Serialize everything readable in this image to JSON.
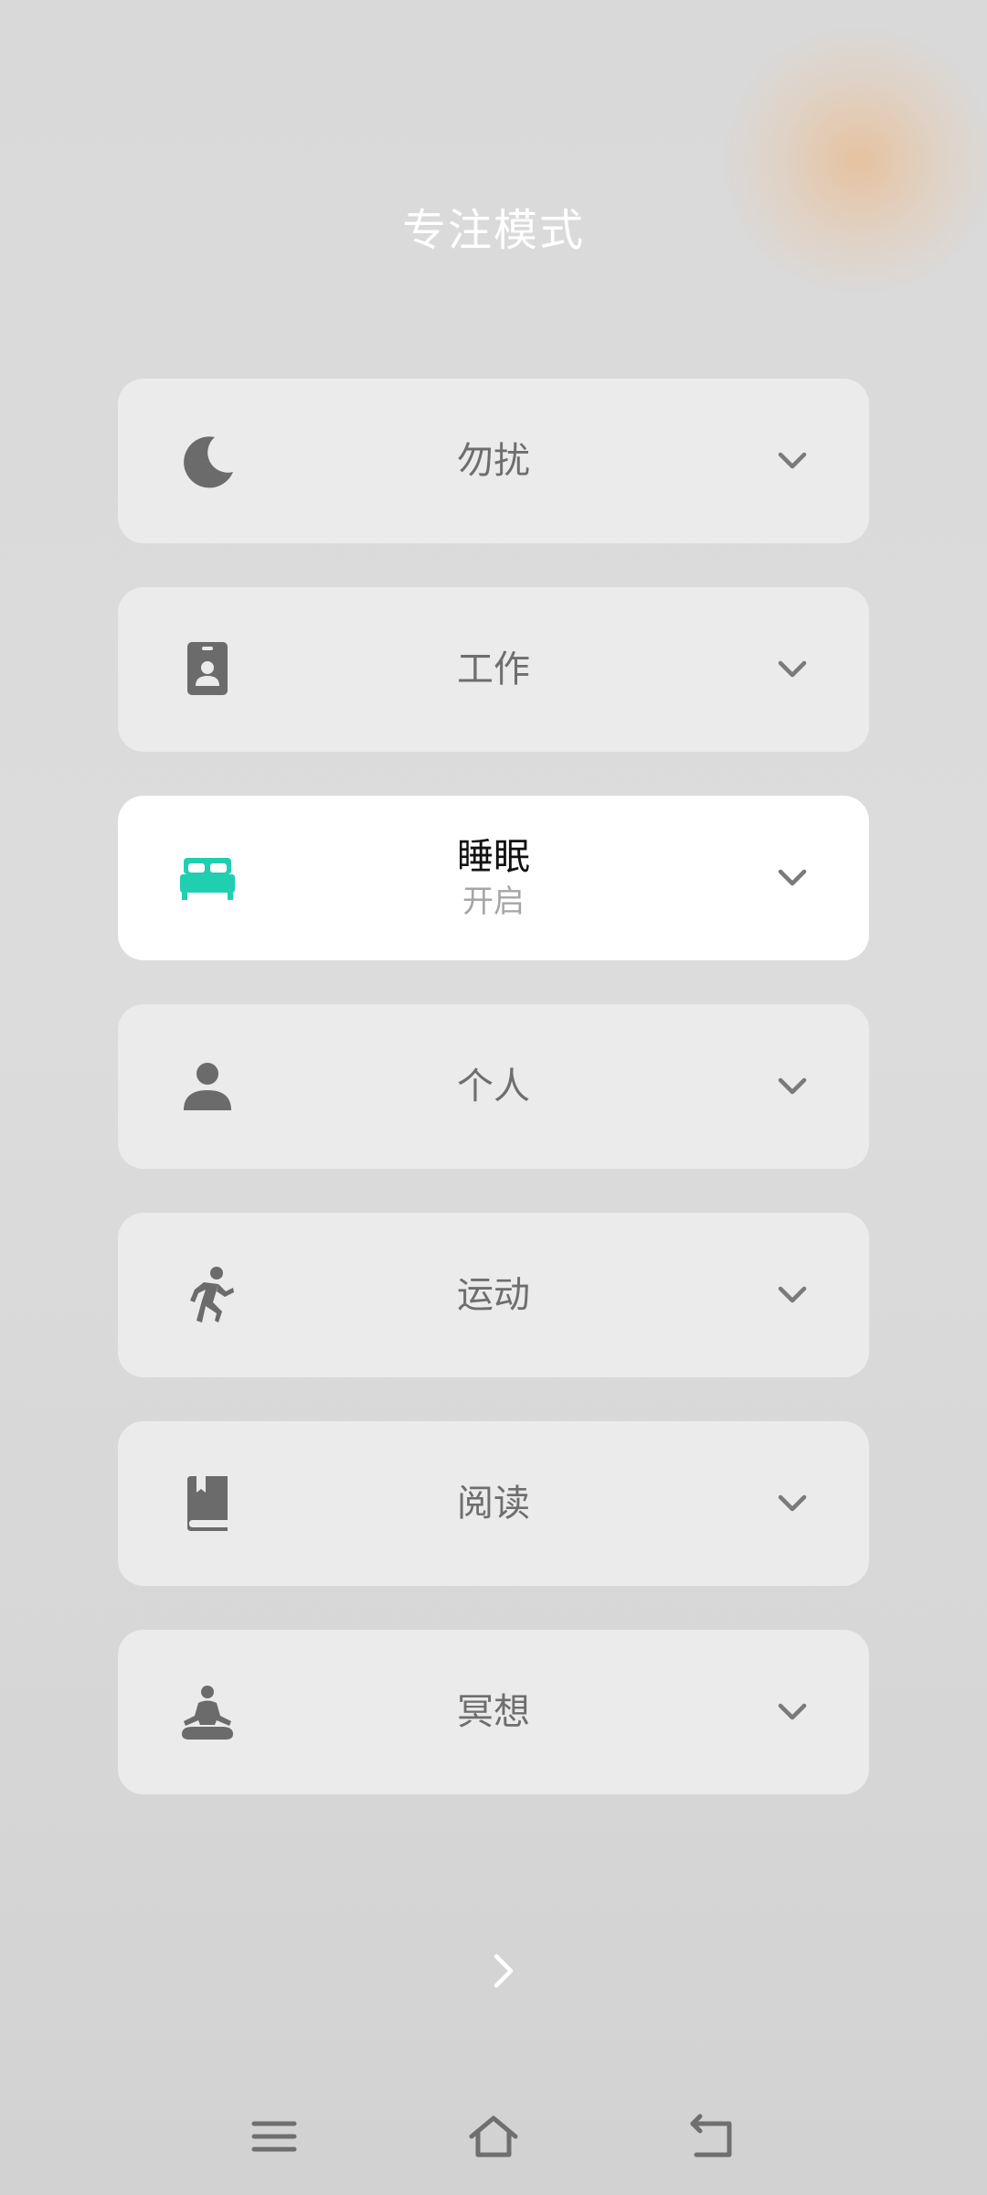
{
  "title": "专注模式",
  "modes": [
    {
      "id": "dnd",
      "icon": "moon-icon",
      "label": "勿扰",
      "status": "",
      "active": false
    },
    {
      "id": "work",
      "icon": "badge-icon",
      "label": "工作",
      "status": "",
      "active": false
    },
    {
      "id": "sleep",
      "icon": "bed-icon",
      "label": "睡眠",
      "status": "开启",
      "active": true
    },
    {
      "id": "personal",
      "icon": "person-icon",
      "label": "个人",
      "status": "",
      "active": false
    },
    {
      "id": "exercise",
      "icon": "running-icon",
      "label": "运动",
      "status": "",
      "active": false
    },
    {
      "id": "reading",
      "icon": "book-icon",
      "label": "阅读",
      "status": "",
      "active": false
    },
    {
      "id": "meditation",
      "icon": "meditation-icon",
      "label": "冥想",
      "status": "",
      "active": false
    }
  ],
  "bottom_link": {
    "label": "",
    "icon": "chevron-right-icon"
  },
  "navbar": {
    "menu_icon": "menu-icon",
    "home_icon": "home-icon",
    "back_icon": "back-icon"
  },
  "colors": {
    "accent": "#1fcfb0",
    "icon_gray": "#6b6b6b",
    "card_bg": "#ebebeb",
    "active_bg": "#ffffff"
  }
}
